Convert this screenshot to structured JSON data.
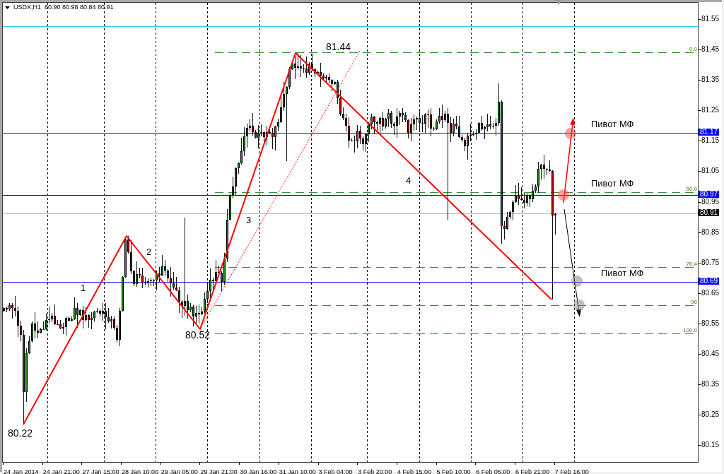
{
  "chart_header": {
    "symbol": "USDX,H1",
    "ohlc": "80.90 80.98 80.84 80.91"
  },
  "price_axis": {
    "labels": [
      "81.55",
      "81.45",
      "81.35",
      "81.25",
      "81.15",
      "81.05",
      "80.95",
      "80.85",
      "80.75",
      "80.65",
      "80.55",
      "80.45",
      "80.35",
      "80.25",
      "80.15"
    ],
    "tags": [
      {
        "text": "81.17",
        "kind": "line"
      },
      {
        "text": "80.97",
        "kind": "line"
      },
      {
        "text": "80.91",
        "kind": "bid"
      },
      {
        "text": "80.69",
        "kind": "line"
      }
    ]
  },
  "time_axis": {
    "labels": [
      "24 Jan 2014",
      "24 Jan 21:00",
      "27 Jan 15:00",
      "28 Jan 10:00",
      "29 Jan 05:00",
      "29 Jan 21:00",
      "30 Jan 16:00",
      "31 Jan 10:00",
      "3 Feb 04:00",
      "3 Feb 20:00",
      "4 Feb 15:00",
      "5 Feb 10:00",
      "6 Feb 05:00",
      "6 Feb 21:00",
      "7 Feb 16:00"
    ]
  },
  "fibonacci": {
    "levels": [
      {
        "label": "0.0"
      },
      {
        "label": "50.0"
      },
      {
        "label": "76.4"
      },
      {
        "label": "90"
      },
      {
        "label": "100.0"
      }
    ]
  },
  "zigzag": {
    "swing_labels": [
      "80.22",
      "80.52",
      "81.44"
    ],
    "wave_labels": [
      "1",
      "2",
      "3",
      "4"
    ]
  },
  "pivot_labels": [
    "Пивот МФ",
    "Пивот МФ",
    "Пивот МФ"
  ]
}
